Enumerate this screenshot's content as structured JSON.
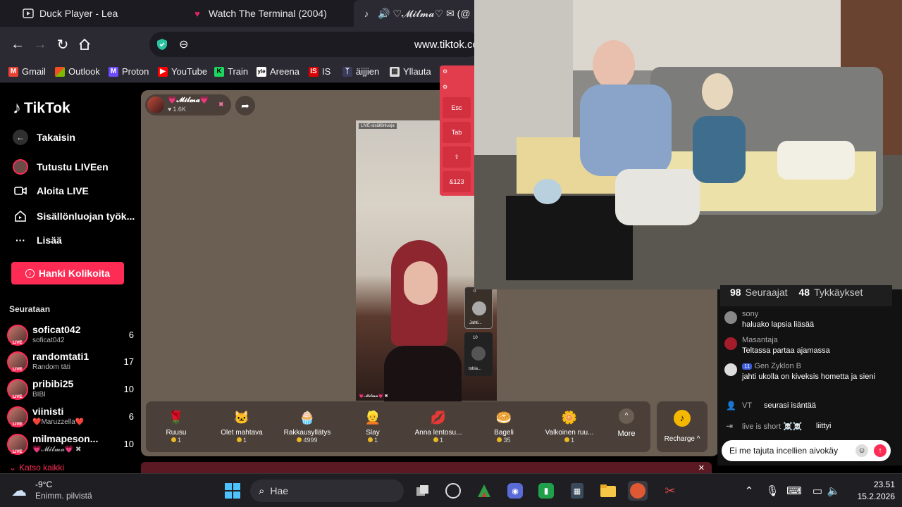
{
  "browser": {
    "tabs": [
      {
        "title": "Duck Player - Lea",
        "icon": "duck-player-icon"
      },
      {
        "title": "Watch The Terminal (2004)",
        "icon": "heart-icon"
      },
      {
        "title": "🔊 ♡𝓜𝓲𝓵𝓶𝓪♡ ✉ (@",
        "icon": "tiktok-icon"
      }
    ],
    "url": "www.tiktok.co",
    "bookmarks": [
      "Gmail",
      "Outlook",
      "Proton",
      "YouTube",
      "Train",
      "Areena",
      "IS",
      "äijjien",
      "Yllauta"
    ]
  },
  "tiktok": {
    "logo": "TikTok",
    "nav": {
      "back": "Takaisin",
      "explore": "Tutustu LIVEen",
      "go_live": "Aloita LIVE",
      "creator_tools": "Sisällönluojan työk...",
      "more": "Lisää"
    },
    "coins_button": "Hanki Kolikoita",
    "following_header": "Seurataan",
    "following": [
      {
        "name": "soficat042",
        "sub": "soficat042",
        "count": "6"
      },
      {
        "name": "randomtati1",
        "sub": "Random täti",
        "count": "17"
      },
      {
        "name": "pribibi25",
        "sub": "BIBI",
        "count": "10"
      },
      {
        "name": "viinisti",
        "sub": "❤️Maruzzella❤️",
        "count": "6"
      },
      {
        "name": "milmapeson...",
        "sub": "💗𝓜𝓲𝓵𝓶𝓪💗 ✖",
        "count": "10"
      }
    ],
    "see_all": "Katso kaikki",
    "host": {
      "name": "💗𝓜𝓲𝓵𝓶𝓪💗",
      "viewers": "1.6K"
    },
    "video_label": "LIVE-sisällönluoja",
    "video_bottom_name": "💗𝓜𝓲𝓵𝓶𝓪💗 ✖",
    "guests": [
      {
        "count": "0",
        "name": "Jahti..."
      },
      {
        "count": "10",
        "name": "tobia..."
      }
    ],
    "keyboard": {
      "esc": "Esc",
      "tab": "Tab",
      "shift": "⇧",
      "num": "&123"
    },
    "gifts": [
      {
        "name": "Ruusu",
        "price": "1",
        "icon": "🌹"
      },
      {
        "name": "Olet mahtava",
        "price": "1",
        "icon": "🐱"
      },
      {
        "name": "Rakkausyllätys",
        "price": "4999",
        "icon": "🧁"
      },
      {
        "name": "Slay",
        "price": "1",
        "icon": "👱"
      },
      {
        "name": "Anna lentosu...",
        "price": "1",
        "icon": "💋"
      },
      {
        "name": "Bageli",
        "price": "35",
        "icon": "🥯"
      },
      {
        "name": "Valkoinen ruu...",
        "price": "1",
        "icon": "🌼"
      }
    ],
    "more_label": "More",
    "recharge_label": "Recharge ^",
    "stats": {
      "followers": "98",
      "followers_label": "Seuraajat",
      "likes": "48",
      "likes_label": "Tykkäykset"
    },
    "chat": [
      {
        "name": "sony",
        "text": "haluako lapsia liäsää"
      },
      {
        "name": "Masantaja",
        "text": "Teltassa partaa ajamassa"
      },
      {
        "name": "Gen Zyklon B",
        "badge": "11",
        "text": "jahti ukolla on kiveksis hometta ja sieni"
      }
    ],
    "joined": {
      "name": "VT",
      "text": "seurasi isäntää"
    },
    "joined2": {
      "name": "live is short ☠️☠️",
      "text": "liittyi"
    },
    "chat_input": "Ei me tajuta incellien aivokäy"
  },
  "taskbar": {
    "weather_temp": "-9°C",
    "weather_desc": "Enimm. pilvistä",
    "search": "Hae",
    "time": "23.51",
    "date": "15.2.2026"
  }
}
